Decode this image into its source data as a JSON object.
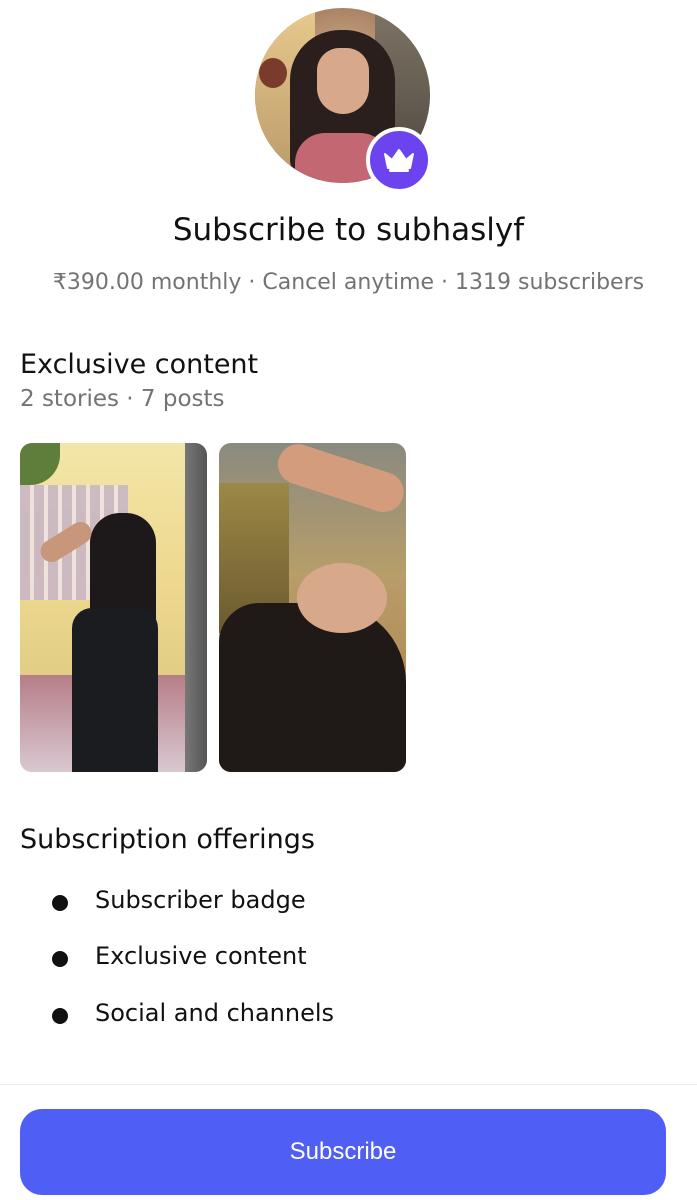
{
  "profile": {
    "avatar_icon": "profile-photo",
    "badge_icon": "crown-icon",
    "badge_color": "#6b44f0"
  },
  "header": {
    "title": "Subscribe to subhaslyf",
    "meta": "₹390.00 monthly · Cancel anytime · 1319 subscribers"
  },
  "exclusive": {
    "title": "Exclusive content",
    "counts": "2 stories · 7 posts",
    "previews": [
      {
        "type": "story"
      },
      {
        "type": "story"
      }
    ]
  },
  "offerings": {
    "title": "Subscription offerings",
    "items": [
      {
        "label": "Subscriber badge"
      },
      {
        "label": "Exclusive content"
      },
      {
        "label": "Social and channels"
      }
    ]
  },
  "footer": {
    "subscribe_label": "Subscribe",
    "button_color": "#4f5ff5"
  }
}
